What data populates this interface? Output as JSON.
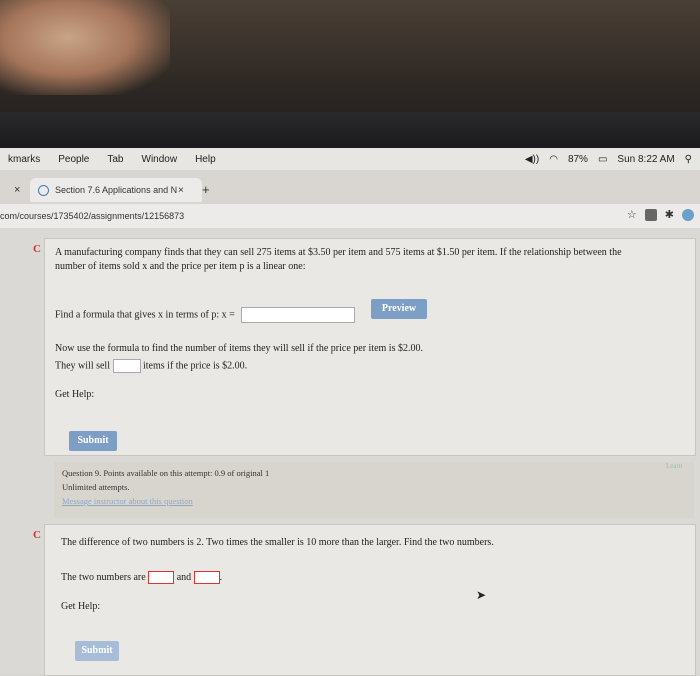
{
  "menubar": {
    "items": [
      "kmarks",
      "People",
      "Tab",
      "Window",
      "Help"
    ],
    "battery": "87%",
    "clock": "Sun 8:22 AM"
  },
  "tabs": {
    "active_title": "Section 7.6 Applications and N",
    "close": "×",
    "left_close": "×",
    "new_tab": "+"
  },
  "address": {
    "url": "com/courses/1735402/assignments/12156873",
    "star": "☆"
  },
  "question1": {
    "intro_line1": "A manufacturing company finds that they can sell 275 items at $3.50 per item and 575 items at $1.50 per item. If the relationship between the",
    "intro_line2": "number of items sold x and the price per item p is a linear one:",
    "formula_prompt": "Find a formula that gives x in terms of p: x =",
    "preview_label": "Preview",
    "part2_line1": "Now use the formula to find the number of items they will sell if the price per item is $2.00.",
    "part2_prefix": "They will sell",
    "part2_suffix": "items if the price is $2.00.",
    "get_help": "Get Help:",
    "submit_label": "Submit"
  },
  "question_info": {
    "line1": "Question 9. Points available on this attempt: 0.9 of original 1",
    "line2": "Unlimited attempts.",
    "link": "Message instructor about this question",
    "learn": "Learn"
  },
  "question2": {
    "prompt": "The difference of two numbers is 2. Two times the smaller is 10 more than the larger. Find the two numbers.",
    "answer_prefix": "The two numbers are",
    "and": "and",
    "period": ".",
    "get_help": "Get Help:",
    "submit_label": "Submit"
  },
  "icons": {
    "reload": "C",
    "cursor": "➤"
  }
}
